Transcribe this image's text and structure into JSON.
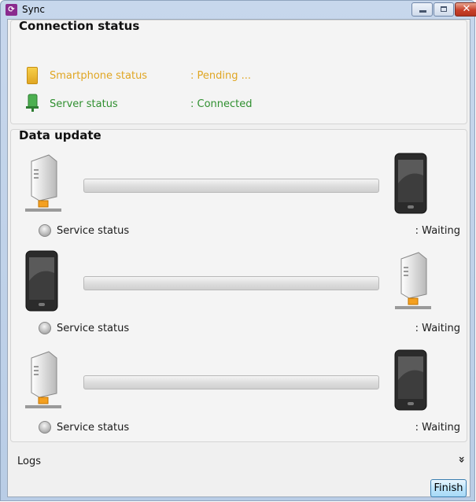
{
  "window": {
    "title": "Sync",
    "close_glyph": "✕"
  },
  "connection_status": {
    "title": "Connection status",
    "rows": [
      {
        "label": "Smartphone status",
        "value": ": Pending ...",
        "color": "#e0a623",
        "icon": "smartphone-icon"
      },
      {
        "label": "Server status",
        "value": ": Connected",
        "color": "#2f8f2f",
        "icon": "server-connected-icon"
      }
    ]
  },
  "data_update": {
    "title": "Data update",
    "rows": [
      {
        "source_icon": "server-icon",
        "target_icon": "phone-icon",
        "label": "Service status",
        "value": ": Waiting",
        "progress": 0
      },
      {
        "source_icon": "phone-icon",
        "target_icon": "server-icon",
        "label": "Service status",
        "value": ": Waiting",
        "progress": 0
      },
      {
        "source_icon": "server-icon",
        "target_icon": "phone-icon",
        "label": "Service status",
        "value": ": Waiting",
        "progress": 0
      }
    ]
  },
  "logs": {
    "label": "Logs",
    "chevron": "»"
  },
  "footer": {
    "finish_label": "Finish"
  }
}
